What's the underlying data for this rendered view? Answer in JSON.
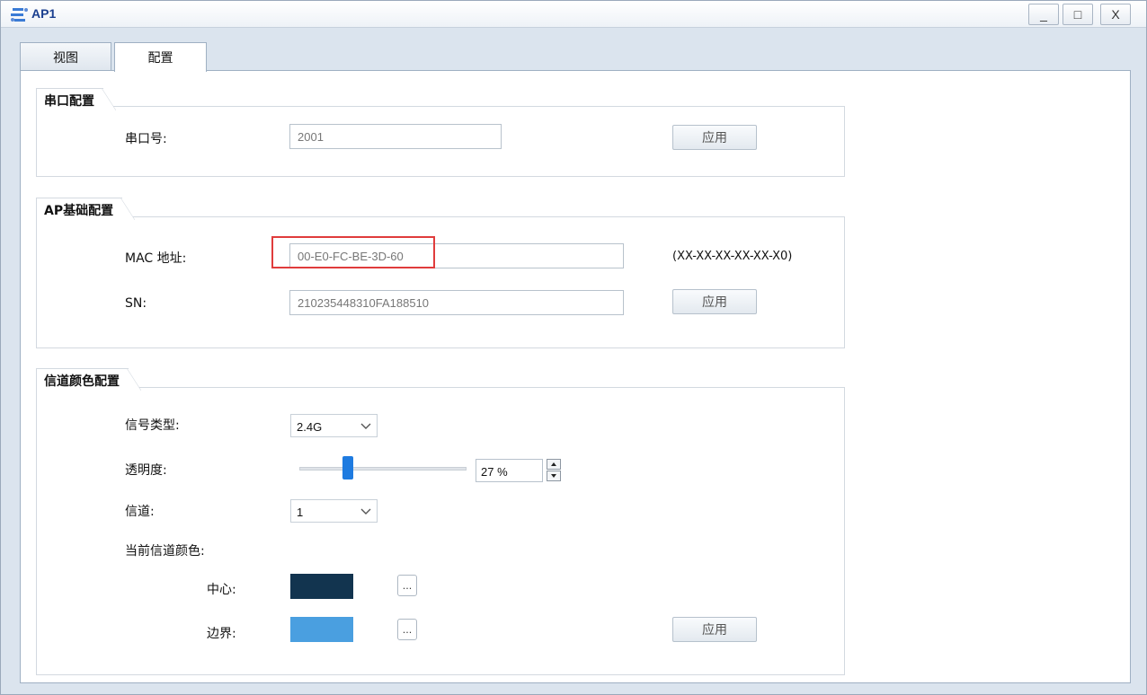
{
  "window": {
    "title": "AP1",
    "controls": {
      "minimize": "_",
      "maximize": "□",
      "close": "X"
    }
  },
  "tabs": [
    {
      "label": "视图",
      "active": false
    },
    {
      "label": "配置",
      "active": true
    }
  ],
  "serial": {
    "group_title": "串口配置",
    "port_label": "串口号:",
    "port_value": "2001",
    "apply": "应用"
  },
  "ap_basic": {
    "group_title": "AP基础配置",
    "mac_label": "MAC 地址:",
    "mac_value": "00-E0-FC-BE-3D-60",
    "mac_hint": "(XX-XX-XX-XX-XX-X0)",
    "sn_label": "SN:",
    "sn_value": "210235448310FA188510",
    "apply": "应用"
  },
  "channel_color": {
    "group_title": "信道颜色配置",
    "signal_label": "信号类型:",
    "signal_value": "2.4G",
    "opacity_label": "透明度:",
    "opacity_value": "27 %",
    "opacity_fraction": 0.27,
    "channel_label": "信道:",
    "channel_value": "1",
    "current_color_label": "当前信道颜色:",
    "center_label": "中心:",
    "center_color": "#12344f",
    "border_label": "边界:",
    "border_color": "#4a9fe0",
    "ellipsis": "...",
    "apply": "应用"
  },
  "colors": {
    "highlight": "#e03c3c",
    "slider_thumb": "#1e7be0"
  }
}
